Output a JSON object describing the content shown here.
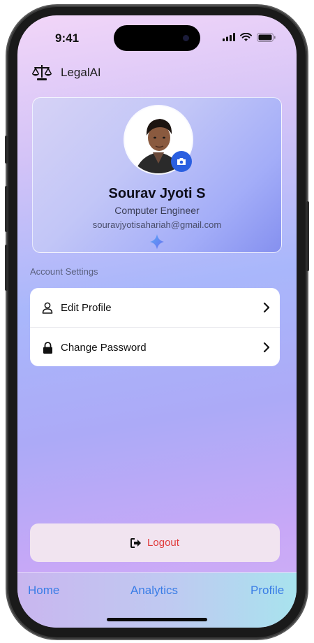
{
  "status_bar": {
    "time": "9:41"
  },
  "header": {
    "app_title": "LegalAI",
    "logo_icon": "scales-icon"
  },
  "profile": {
    "name": "Sourav Jyoti S",
    "role": "Computer Engineer",
    "email": "souravjyotisahariah@gmail.com"
  },
  "account_settings": {
    "section_label": "Account Settings",
    "items": [
      {
        "label": "Edit Profile",
        "icon": "user-icon"
      },
      {
        "label": "Change Password",
        "icon": "lock-icon"
      }
    ]
  },
  "logout": {
    "label": "Logout",
    "icon": "sign-out-icon"
  },
  "tab_bar": {
    "tabs": [
      {
        "label": "Home"
      },
      {
        "label": "Analytics"
      },
      {
        "label": "Profile"
      }
    ]
  },
  "colors": {
    "accent_blue": "#3a7de6",
    "camera_blue": "#2a5fe0",
    "logout_red": "#e03a3a"
  }
}
